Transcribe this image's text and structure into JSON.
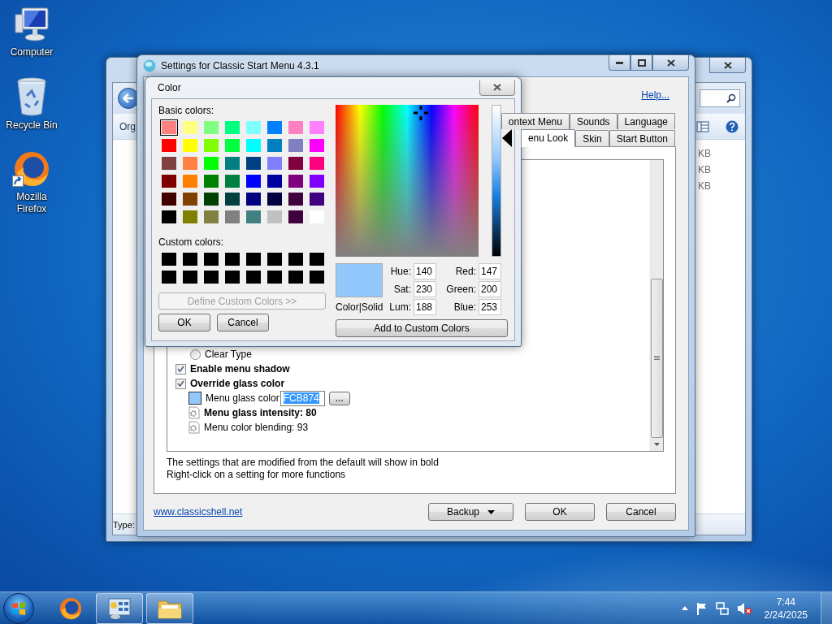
{
  "desktop_icons": [
    {
      "kind": "computer",
      "label": "Computer",
      "shortcut": false
    },
    {
      "kind": "recycle-bin",
      "label": "Recycle Bin",
      "shortcut": false
    },
    {
      "kind": "firefox",
      "label": "Mozilla Firefox",
      "shortcut": true
    }
  ],
  "explorer_window": {
    "command_text": "Org",
    "size_cells": [
      "KB",
      "KB",
      "KB"
    ],
    "status_text": "Type:"
  },
  "settings_window": {
    "title": "Settings for Classic Start Menu 4.3.1",
    "help_link": "Help...",
    "tab_rows": [
      [
        {
          "label": "ontext Menu",
          "selected": false
        },
        {
          "label": "Sounds",
          "selected": false
        },
        {
          "label": "Language",
          "selected": false
        }
      ],
      [
        {
          "label": "enu Look",
          "selected": true
        },
        {
          "label": "Skin",
          "selected": false
        },
        {
          "label": "Start Button",
          "selected": false
        }
      ]
    ],
    "settings": [
      {
        "kind": "radio",
        "label": "Clear Type",
        "checked": false,
        "modified": false
      },
      {
        "kind": "checkbox",
        "label": "Enable menu shadow",
        "checked": true,
        "modified": true
      },
      {
        "kind": "checkbox",
        "label": "Override glass color",
        "checked": true,
        "modified": true,
        "children": [
          {
            "kind": "color",
            "label": "Menu glass color",
            "value": "FCB874",
            "browse_button": "...",
            "color": "#93c8fd",
            "modified": false
          },
          {
            "kind": "value",
            "label": "Menu glass intensity: 80",
            "modified": true
          },
          {
            "kind": "value",
            "label": "Menu color blending: 93",
            "modified": false
          }
        ]
      }
    ],
    "hint_lines": [
      "The settings that are modified from the default will show in bold",
      "Right-click on a setting for more functions"
    ],
    "website_link": "www.classicshell.net",
    "buttons": [
      {
        "kind": "dropdown",
        "label": "Backup"
      },
      {
        "kind": "plain",
        "label": "OK"
      },
      {
        "kind": "plain",
        "label": "Cancel"
      }
    ]
  },
  "color_dialog": {
    "title": "Color",
    "basic_label": "Basic colors:",
    "basic_colors": [
      {
        "color": "#ff8080",
        "selected": true
      },
      {
        "color": "#ffff80",
        "selected": false
      },
      {
        "color": "#80ff80",
        "selected": false
      },
      {
        "color": "#00ff80",
        "selected": false
      },
      {
        "color": "#80ffff",
        "selected": false
      },
      {
        "color": "#0080ff",
        "selected": false
      },
      {
        "color": "#ff80c0",
        "selected": false
      },
      {
        "color": "#ff80ff",
        "selected": false
      },
      {
        "color": "#ff0000",
        "selected": false
      },
      {
        "color": "#ffff00",
        "selected": false
      },
      {
        "color": "#80ff00",
        "selected": false
      },
      {
        "color": "#00ff40",
        "selected": false
      },
      {
        "color": "#00ffff",
        "selected": false
      },
      {
        "color": "#0080c0",
        "selected": false
      },
      {
        "color": "#8080c0",
        "selected": false
      },
      {
        "color": "#ff00ff",
        "selected": false
      },
      {
        "color": "#804040",
        "selected": false
      },
      {
        "color": "#ff8040",
        "selected": false
      },
      {
        "color": "#00ff00",
        "selected": false
      },
      {
        "color": "#008080",
        "selected": false
      },
      {
        "color": "#004080",
        "selected": false
      },
      {
        "color": "#8080ff",
        "selected": false
      },
      {
        "color": "#800040",
        "selected": false
      },
      {
        "color": "#ff0080",
        "selected": false
      },
      {
        "color": "#800000",
        "selected": false
      },
      {
        "color": "#ff8000",
        "selected": false
      },
      {
        "color": "#008000",
        "selected": false
      },
      {
        "color": "#008040",
        "selected": false
      },
      {
        "color": "#0000ff",
        "selected": false
      },
      {
        "color": "#0000a0",
        "selected": false
      },
      {
        "color": "#800080",
        "selected": false
      },
      {
        "color": "#8000ff",
        "selected": false
      },
      {
        "color": "#400000",
        "selected": false
      },
      {
        "color": "#804000",
        "selected": false
      },
      {
        "color": "#004000",
        "selected": false
      },
      {
        "color": "#004040",
        "selected": false
      },
      {
        "color": "#000080",
        "selected": false
      },
      {
        "color": "#000040",
        "selected": false
      },
      {
        "color": "#400040",
        "selected": false
      },
      {
        "color": "#400080",
        "selected": false
      },
      {
        "color": "#000000",
        "selected": false
      },
      {
        "color": "#808000",
        "selected": false
      },
      {
        "color": "#808040",
        "selected": false
      },
      {
        "color": "#808080",
        "selected": false
      },
      {
        "color": "#408080",
        "selected": false
      },
      {
        "color": "#c0c0c0",
        "selected": false
      },
      {
        "color": "#400040",
        "selected": false
      },
      {
        "color": "#ffffff",
        "selected": false
      }
    ],
    "custom_label": "Custom colors:",
    "custom_colors": [
      {
        "color": "#000000"
      },
      {
        "color": "#000000"
      },
      {
        "color": "#000000"
      },
      {
        "color": "#000000"
      },
      {
        "color": "#000000"
      },
      {
        "color": "#000000"
      },
      {
        "color": "#000000"
      },
      {
        "color": "#000000"
      },
      {
        "color": "#000000"
      },
      {
        "color": "#000000"
      },
      {
        "color": "#000000"
      },
      {
        "color": "#000000"
      },
      {
        "color": "#000000"
      },
      {
        "color": "#000000"
      },
      {
        "color": "#000000"
      },
      {
        "color": "#000000"
      }
    ],
    "define_button": {
      "label": "Define Custom Colors >>",
      "disabled": true
    },
    "buttons": [
      "OK",
      "Cancel"
    ],
    "luminance": {
      "level": 0.78
    },
    "preview": {
      "color": "#93c8fd",
      "label": "Color|Solid"
    },
    "fields": [
      {
        "label": "Hue:",
        "value": "140"
      },
      {
        "label": "Red:",
        "value": "147"
      },
      {
        "label": "Sat:",
        "value": "230"
      },
      {
        "label": "Green:",
        "value": "200"
      },
      {
        "label": "Lum:",
        "value": "188"
      },
      {
        "label": "Blue:",
        "value": "253"
      }
    ],
    "add_button": "Add to Custom Colors"
  },
  "taskbar": {
    "apps": [
      {
        "kind": "firefox",
        "open": false
      },
      {
        "kind": "control-panel",
        "open": true
      },
      {
        "kind": "folder",
        "open": true
      }
    ],
    "clock": {
      "time": "7:44",
      "date": "2/24/2025"
    }
  }
}
